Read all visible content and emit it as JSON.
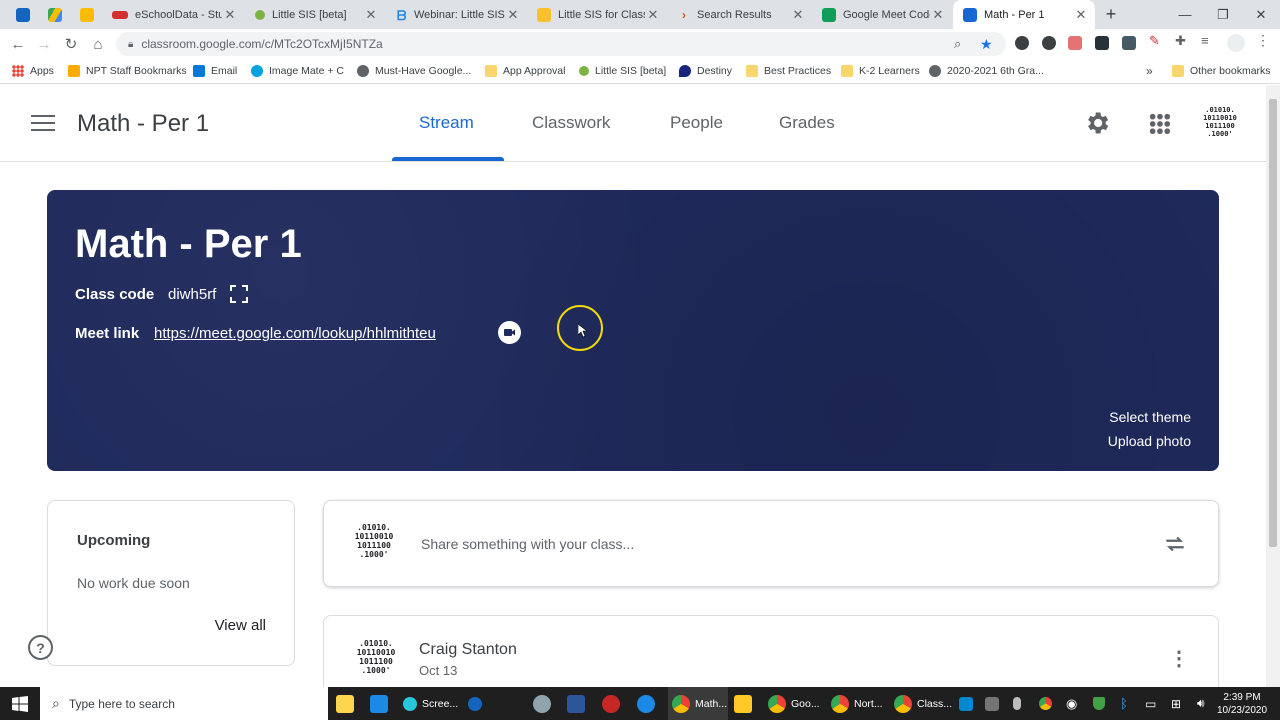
{
  "browser": {
    "tabs": [
      {
        "label": "",
        "color": "#1565c0"
      },
      {
        "label": "",
        "color": "#34a853"
      },
      {
        "label": "",
        "color": "#fbbc04"
      },
      {
        "label": "eSchoolData - Stud",
        "color": "#d32f2f"
      },
      {
        "label": "Little SIS [beta]",
        "color": "#7cb342"
      },
      {
        "label": "Webinar: Little SIS f",
        "color": "#1e88e5"
      },
      {
        "label": "Little SIS for Classro",
        "color": "#fbc02d"
      },
      {
        "label": "Search Results",
        "color": "#e65100"
      },
      {
        "label": "Google Meet Code",
        "color": "#0f9d58"
      },
      {
        "label": "Math - Per 1",
        "color": "#1967d2"
      }
    ],
    "url": "classroom.google.com/c/MTc2OTcxMjI5NTZa",
    "bookmarks": [
      {
        "label": "Apps",
        "color": "#ea4335"
      },
      {
        "label": "NPT Staff Bookmarks",
        "color": "#f9ab00"
      },
      {
        "label": "Email",
        "color": "#0078d4"
      },
      {
        "label": "Image Mate + C",
        "color": "#00a1e0"
      },
      {
        "label": "Must-Have Google...",
        "color": "#5f6368"
      },
      {
        "label": "App Approval",
        "color": "#f9d56e"
      },
      {
        "label": "Little SIS [beta]",
        "color": "#7cb342"
      },
      {
        "label": "Destiny",
        "color": "#1a237e"
      },
      {
        "label": "Best Practices",
        "color": "#f9d56e"
      },
      {
        "label": "K-2 Learners",
        "color": "#f9d56e"
      },
      {
        "label": "2020-2021 6th Gra...",
        "color": "#5f6368"
      }
    ],
    "other_bookmarks": "Other bookmarks",
    "more_bookmarks": "»"
  },
  "app": {
    "title": "Math - Per 1",
    "nav": {
      "stream": "Stream",
      "classwork": "Classwork",
      "people": "People",
      "grades": "Grades"
    },
    "avatar_text": ".01010.\n10110010\n1011100\n.1000'"
  },
  "banner": {
    "title": "Math - Per 1",
    "class_code_label": "Class code",
    "class_code": "diwh5rf",
    "meet_label": "Meet link",
    "meet_url": "https://meet.google.com/lookup/hhlmithteu",
    "select_theme": "Select theme",
    "upload_photo": "Upload photo",
    "bg_color": "#1f2a5c"
  },
  "upcoming": {
    "title": "Upcoming",
    "status": "No work due soon",
    "view_all": "View all"
  },
  "share": {
    "placeholder": "Share something with your class..."
  },
  "post": {
    "author": "Craig Stanton",
    "date": "Oct 13"
  },
  "taskbar": {
    "search": "Type here to search",
    "items": [
      "Scree...",
      "Math...",
      "Goo...",
      "Nort...",
      "Class..."
    ],
    "time": "2:39 PM",
    "date": "10/23/2020"
  }
}
